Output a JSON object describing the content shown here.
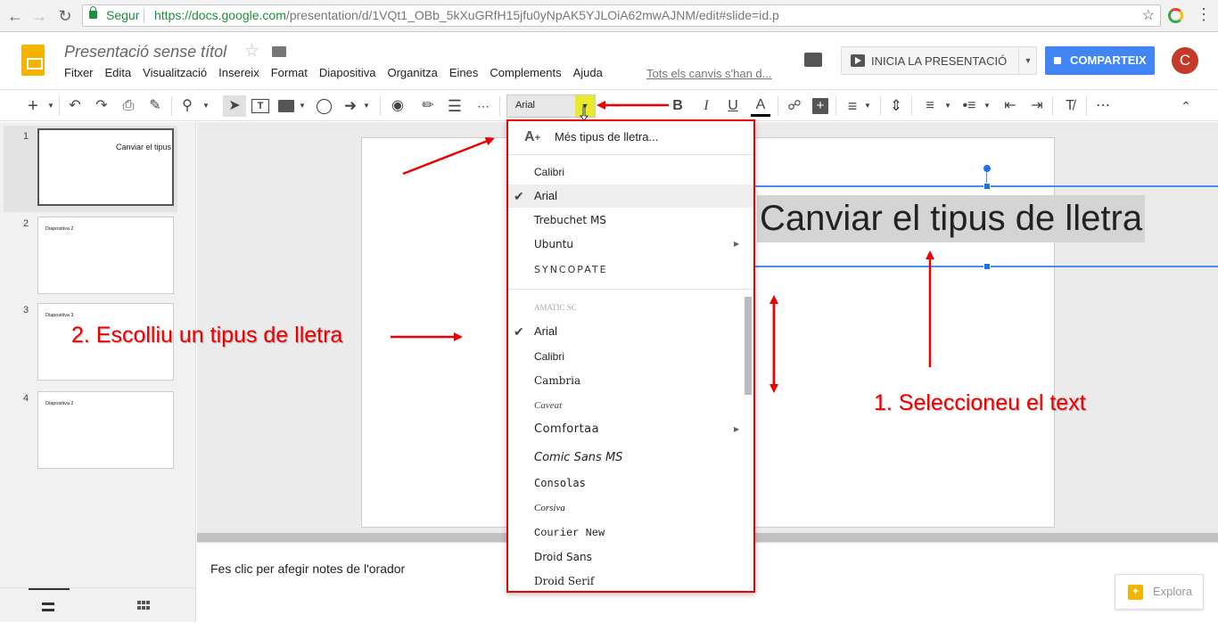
{
  "browser": {
    "secure_label": "Segur",
    "url_host": "https://docs.google.com",
    "url_path": "/presentation/d/1VQt1_OBb_5kXuGRfH15jfu0yNpAK5YJLOiA62mwAJNM/edit#slide=id.p"
  },
  "app": {
    "doc_title": "Presentació sense títol",
    "menu": [
      "Fitxer",
      "Edita",
      "Visualització",
      "Insereix",
      "Format",
      "Diapositiva",
      "Organitza",
      "Eines",
      "Complements",
      "Ajuda"
    ],
    "saved_status": "Tots els canvis s'han d...",
    "present_label": "INICIA LA PRESENTACIÓ",
    "share_label": "COMPARTEIX",
    "avatar_initial": "C"
  },
  "toolbar": {
    "font_name": "Arial"
  },
  "slides": [
    {
      "num": "1",
      "text": "Canviar el tipus"
    },
    {
      "num": "2",
      "text": "Diapositiva 2"
    },
    {
      "num": "3",
      "text": "Diapositiva 3"
    },
    {
      "num": "4",
      "text": "Diapositiva 2"
    }
  ],
  "canvas": {
    "selected_text": "Canviar el tipus de lletra",
    "notes_placeholder": "Fes clic per afegir notes de l'orador",
    "explore_label": "Explora"
  },
  "font_menu": {
    "more_fonts": "Més tipus de lletra...",
    "recent": [
      {
        "label": "Calibri",
        "checked": false,
        "submenu": false
      },
      {
        "label": "Arial",
        "checked": true,
        "submenu": false
      },
      {
        "label": "Trebuchet MS",
        "checked": false,
        "submenu": false
      },
      {
        "label": "Ubuntu",
        "checked": false,
        "submenu": true
      },
      {
        "label": "SYNCOPATE",
        "checked": false,
        "submenu": false
      }
    ],
    "all": [
      {
        "label": "AMATIC SC",
        "checked": false,
        "submenu": false
      },
      {
        "label": "Arial",
        "checked": true,
        "submenu": false
      },
      {
        "label": "Calibri",
        "checked": false,
        "submenu": false
      },
      {
        "label": "Cambria",
        "checked": false,
        "submenu": false
      },
      {
        "label": "Caveat",
        "checked": false,
        "submenu": false
      },
      {
        "label": "Comfortaa",
        "checked": false,
        "submenu": true
      },
      {
        "label": "Comic Sans MS",
        "checked": false,
        "submenu": false
      },
      {
        "label": "Consolas",
        "checked": false,
        "submenu": false
      },
      {
        "label": "Corsiva",
        "checked": false,
        "submenu": false
      },
      {
        "label": "Courier New",
        "checked": false,
        "submenu": false
      },
      {
        "label": "Droid Sans",
        "checked": false,
        "submenu": false
      },
      {
        "label": "Droid Serif",
        "checked": false,
        "submenu": false
      }
    ]
  },
  "annotations": {
    "step1": "1. Seleccioneu el text",
    "step2": "2. Escolliu un tipus de lletra"
  },
  "colors": {
    "annotation": "#e00000",
    "share_button": "#4285f4",
    "logo": "#f4b400",
    "selection": "#4a8cf0"
  }
}
